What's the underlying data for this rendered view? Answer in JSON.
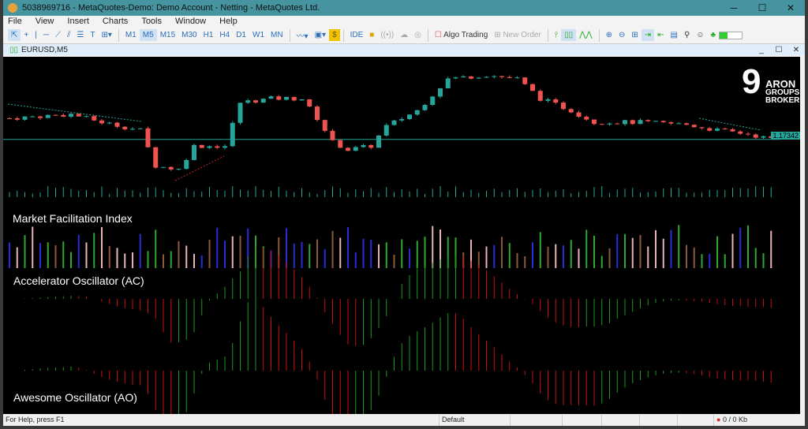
{
  "window": {
    "title": "5038969716 - MetaQuotes-Demo: Demo Account - Netting - MetaQuotes Ltd."
  },
  "menu": [
    "File",
    "View",
    "Insert",
    "Charts",
    "Tools",
    "Window",
    "Help"
  ],
  "toolbar": {
    "timeframes": [
      "M1",
      "M5",
      "M15",
      "M30",
      "H1",
      "H4",
      "D1",
      "W1",
      "MN"
    ],
    "active_timeframe": "M5",
    "ide": "IDE",
    "algo_trading": "Algo Trading",
    "new_order": "New Order"
  },
  "chart": {
    "symbol": "EURUSD,M5",
    "current_price": "1.17342",
    "brand": {
      "nine": "9",
      "line1": "ARON",
      "line2": "GROUPS",
      "line3": "BROKER"
    },
    "indicators": [
      "Market Facilitation Index",
      "Accelerator Oscillator (AC)",
      "Awesome Oscillator (AO)"
    ],
    "colors": {
      "bull": "#26a69a",
      "bear": "#ef5350",
      "mfi": [
        "#2fa82f",
        "#8b5a3c",
        "#2b2bd8",
        "#e8b4b8"
      ]
    },
    "chart_data": {
      "type": "candlestick",
      "candles": 100,
      "price_min": 1.1718,
      "price_max": 1.1765,
      "path": [
        [
          0,
          1.17432
        ],
        [
          8,
          1.17449
        ],
        [
          12,
          1.17415
        ],
        [
          17,
          1.17381
        ],
        [
          19,
          1.1723
        ],
        [
          22,
          1.17214
        ],
        [
          24,
          1.17314
        ],
        [
          28,
          1.17314
        ],
        [
          30,
          1.17499
        ],
        [
          34,
          1.17516
        ],
        [
          38,
          1.17516
        ],
        [
          40,
          1.17432
        ],
        [
          42,
          1.17331
        ],
        [
          44,
          1.17298
        ],
        [
          47,
          1.17314
        ],
        [
          49,
          1.17398
        ],
        [
          53,
          1.17465
        ],
        [
          57,
          1.176
        ],
        [
          62,
          1.17616
        ],
        [
          66,
          1.176
        ],
        [
          69,
          1.17516
        ],
        [
          73,
          1.17465
        ],
        [
          76,
          1.17415
        ],
        [
          82,
          1.17415
        ],
        [
          88,
          1.17405
        ],
        [
          92,
          1.17381
        ],
        [
          96,
          1.17365
        ],
        [
          99,
          1.17342
        ]
      ]
    }
  },
  "status": {
    "help": "For Help, press F1",
    "profile": "Default",
    "traffic": "0 / 0 Kb"
  }
}
